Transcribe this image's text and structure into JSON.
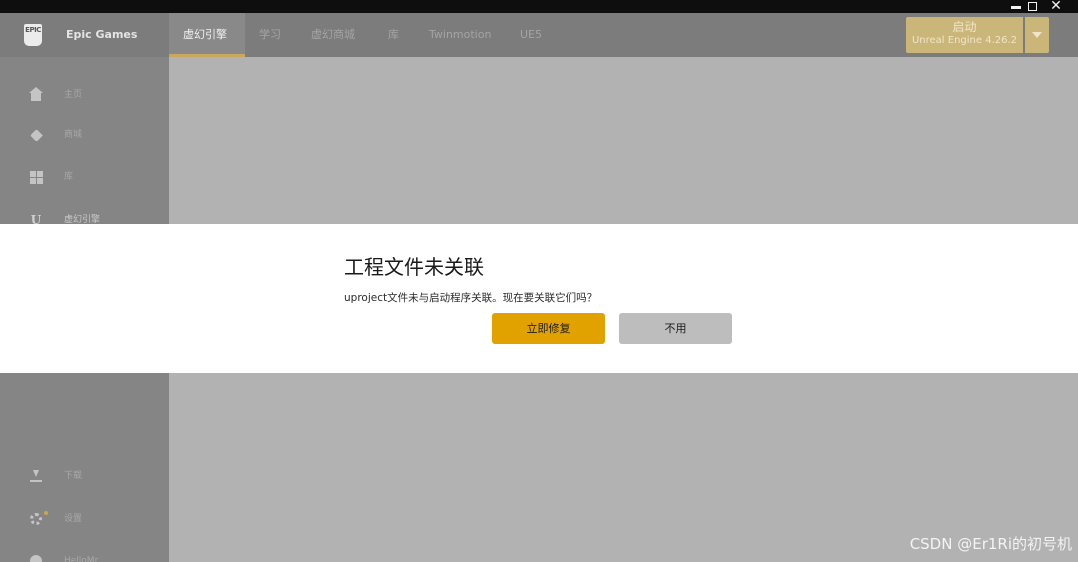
{
  "window": {
    "controls": {
      "close": "✕"
    }
  },
  "header": {
    "logo_text": "EPIC",
    "brand": "Epic Games",
    "tabs": [
      {
        "label": "虚幻引擎",
        "active": true
      },
      {
        "label": "学习",
        "active": false
      },
      {
        "label": "虚幻商城",
        "active": false
      },
      {
        "label": "库",
        "active": false
      },
      {
        "label": "Twinmotion",
        "active": false
      },
      {
        "label": "UE5",
        "active": false
      }
    ],
    "launch": {
      "label": "启动",
      "version": "Unreal Engine 4.26.2"
    }
  },
  "sidebar": {
    "items": [
      {
        "label": "主页",
        "icon": "home-icon"
      },
      {
        "label": "商城",
        "icon": "tag-icon"
      },
      {
        "label": "库",
        "icon": "grid-icon"
      },
      {
        "label": "虚幻引擎",
        "icon": "unreal-icon",
        "icon_text": "U",
        "active": true
      },
      {
        "label": "下载",
        "icon": "download-icon"
      },
      {
        "label": "设置",
        "icon": "gear-icon"
      },
      {
        "label": "HelloMr",
        "icon": "user-icon"
      }
    ]
  },
  "dialog": {
    "title": "工程文件未关联",
    "message": "uproject文件未与启动程序关联。现在要关联它们吗？",
    "confirm_label": "立即修复",
    "cancel_label": "不用"
  },
  "watermark": "CSDN @Er1Ri的初号机",
  "colors": {
    "accent": "#e1a200",
    "launch": "#cbb67a",
    "sidebar": "#858585",
    "content": "#b2b2b2",
    "titlebar": "#0e0e0e"
  }
}
